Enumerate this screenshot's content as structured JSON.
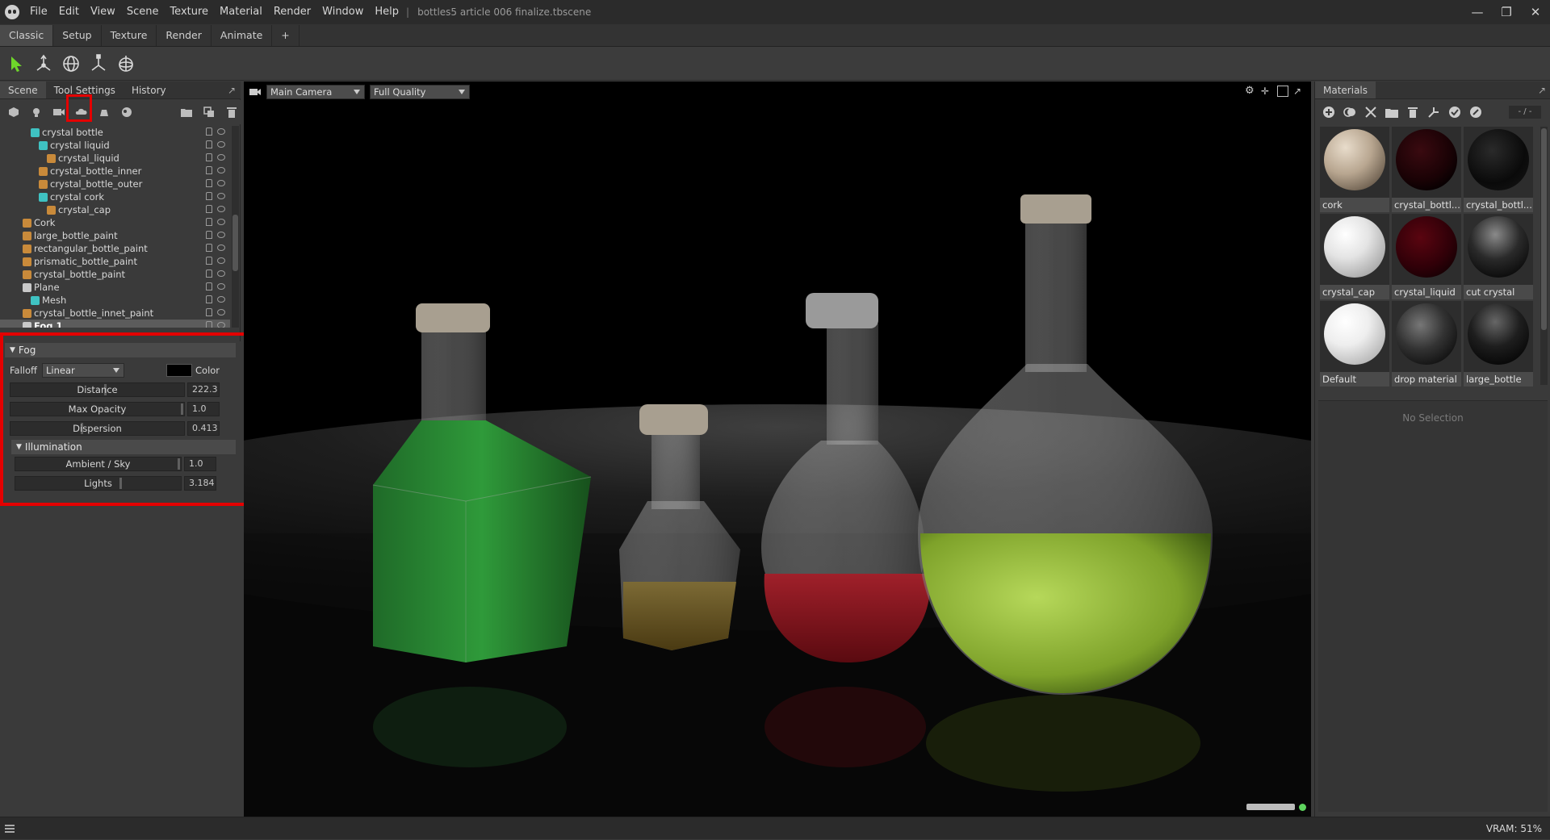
{
  "app": {
    "document_title": "bottles5 article 006 finalize.tbscene",
    "menu": [
      "File",
      "Edit",
      "View",
      "Scene",
      "Texture",
      "Material",
      "Render",
      "Window",
      "Help"
    ]
  },
  "workspace_tabs": [
    "Classic",
    "Setup",
    "Texture",
    "Render",
    "Animate",
    "+"
  ],
  "left_panel": {
    "tabs": [
      "Scene",
      "Tool Settings",
      "History"
    ],
    "tree": [
      {
        "label": "crystal bottle",
        "indent": 2,
        "icon": "cube"
      },
      {
        "label": "crystal liquid",
        "indent": 3,
        "icon": "cube"
      },
      {
        "label": "crystal_liquid",
        "indent": 4,
        "icon": "mat"
      },
      {
        "label": "crystal_bottle_inner",
        "indent": 3,
        "icon": "mat"
      },
      {
        "label": "crystal_bottle_outer",
        "indent": 3,
        "icon": "mat"
      },
      {
        "label": "crystal cork",
        "indent": 3,
        "icon": "cube"
      },
      {
        "label": "crystal_cap",
        "indent": 4,
        "icon": "mat"
      },
      {
        "label": "Cork",
        "indent": 1,
        "icon": "mat"
      },
      {
        "label": "large_bottle_paint",
        "indent": 1,
        "icon": "mat"
      },
      {
        "label": "rectangular_bottle_paint",
        "indent": 1,
        "icon": "mat"
      },
      {
        "label": "prismatic_bottle_paint",
        "indent": 1,
        "icon": "mat"
      },
      {
        "label": "crystal_bottle_paint",
        "indent": 1,
        "icon": "mat"
      },
      {
        "label": "Plane",
        "indent": 1,
        "icon": "plane"
      },
      {
        "label": "Mesh",
        "indent": 2,
        "icon": "cube"
      },
      {
        "label": "crystal_bottle_innet_paint",
        "indent": 1,
        "icon": "mat"
      },
      {
        "label": "Fog 1",
        "indent": 1,
        "icon": "plane",
        "selected": true
      }
    ]
  },
  "fog": {
    "title": "Fog",
    "falloff_label": "Falloff",
    "falloff_value": "Linear",
    "color_label": "Color",
    "color_value": "#000000",
    "distance": {
      "label": "Distance",
      "value": "222.3",
      "level": 0.55
    },
    "max_opacity": {
      "label": "Max Opacity",
      "value": "1.0",
      "level": 1.0
    },
    "dispersion": {
      "label": "Dispersion",
      "value": "0.413",
      "level": 0.41
    },
    "illumination_title": "Illumination",
    "ambient_sky": {
      "label": "Ambient / Sky",
      "value": "1.0",
      "level": 1.0
    },
    "lights": {
      "label": "Lights",
      "value": "3.184",
      "level": 0.64
    }
  },
  "viewport": {
    "camera": "Main Camera",
    "quality": "Full Quality"
  },
  "materials": {
    "tab": "Materials",
    "page": "- / -",
    "items": [
      {
        "name": "cork",
        "style": "radial-gradient(circle at 35% 30%, #e8dccb, #b8a690 45%, #6e6050 80%, #3a332b)"
      },
      {
        "name": "crystal_bottl...",
        "style": "radial-gradient(circle at 40% 35%, #3a0a10, #1a0205 55%, #050001 80%, #6a6a6a 97%)"
      },
      {
        "name": "crystal_bottl...",
        "style": "radial-gradient(circle at 40% 35%, #2a2a2a, #0a0a0a 60%, #111 82%, #8a8a8a 97%)"
      },
      {
        "name": "crystal_cap",
        "style": "radial-gradient(circle at 35% 30%, #ffffff, #e4e4e4 40%, #a8a8a8 80%, #6a6a6a)"
      },
      {
        "name": "crystal_liquid",
        "style": "radial-gradient(circle at 40% 35%, #5a0510, #300008 55%, #120003 85%, #503035)"
      },
      {
        "name": "cut crystal",
        "style": "radial-gradient(circle at 45% 30%, #8a8a8a, #2a2a2a 45%, #0c0c0c 80%, #5a5a5a 97%)"
      },
      {
        "name": "Default",
        "style": "radial-gradient(circle at 35% 30%, #ffffff, #eeeeee 40%, #b6b6b6 80%, #7a7a7a)"
      },
      {
        "name": "drop material",
        "style": "radial-gradient(circle at 40% 35%, #777, #333 45%, #111 80%, #666 97%)"
      },
      {
        "name": "large_bottle",
        "style": "radial-gradient(circle at 45% 30%, #666, #1e1e1e 45%, #080808 80%, #4e4e4e 97%)"
      }
    ],
    "no_selection": "No Selection"
  },
  "status": {
    "vram": "VRAM: 51%"
  },
  "icons": {
    "select": "select-arrow-icon",
    "translate": "translate-gizmo-icon",
    "rotate": "rotate-gizmo-icon",
    "scale": "scale-gizmo-icon",
    "rotate-scale": "orbit-gizmo-icon"
  }
}
